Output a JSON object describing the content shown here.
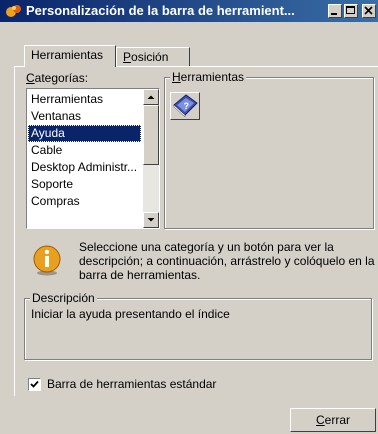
{
  "window": {
    "title": "Personalización de la barra de herramient...",
    "buttons": [
      "minimize-icon",
      "maximize-icon",
      "close-icon"
    ]
  },
  "tabs": [
    {
      "label": "Herramientas",
      "active": true
    },
    {
      "label_prefix": "",
      "label_mnemonic": "P",
      "label_rest": "osición",
      "active": false
    }
  ],
  "categories": {
    "label_mnemonic": "C",
    "label_rest": "ategorías:",
    "items": [
      "Herramientas",
      "Ventanas",
      "Ayuda",
      "Cable",
      "Desktop Administr...",
      "Soporte",
      "Compras"
    ],
    "selected": "Ayuda"
  },
  "tools": {
    "legend_mnemonic": "H",
    "legend_rest": "erramientas",
    "items": [
      {
        "icon": "help-book-icon"
      }
    ]
  },
  "info": {
    "icon": "info-icon",
    "text": "Seleccione una categoría y un botón para ver la descripción; a continuación, arrástrelo y colóquelo en la barra de herramientas."
  },
  "description": {
    "legend": "Descripción",
    "text": "Iniciar la ayuda presentando el índice"
  },
  "standard_toolbar": {
    "label": "Barra de herramientas estándar",
    "checked": true
  },
  "close_button": {
    "label_mnemonic": "C",
    "label_rest": "errar"
  },
  "colors": {
    "titlebar_start": "#0a246a",
    "titlebar_end": "#3a6ea5",
    "face": "#d4d0c8",
    "selection": "#0a246a"
  }
}
